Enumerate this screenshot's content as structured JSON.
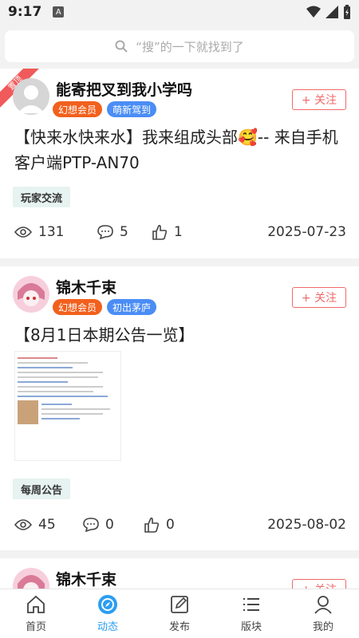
{
  "status_bar": {
    "time": "9:17",
    "a_label": "A"
  },
  "search": {
    "placeholder": "“搜”的一下就找到了"
  },
  "posts": [
    {
      "ribbon": "置顶",
      "user_name": "能寄把叉到我小学吗",
      "tags": [
        "幻想会员",
        "萌新驾到"
      ],
      "follow_label": "+ 关注",
      "title": "【快来水快来水】我来组成头部🥰-- 来自手机客户端PTP-AN70",
      "category": "玩家交流",
      "views": "131",
      "comments": "5",
      "likes": "1",
      "date": "2025-07-23"
    },
    {
      "user_name": "锦木千束",
      "tags": [
        "幻想会员",
        "初出茅庐"
      ],
      "follow_label": "+ 关注",
      "title": "【8月1日本期公告一览】",
      "category": "每周公告",
      "views": "45",
      "comments": "0",
      "likes": "0",
      "date": "2025-08-02"
    },
    {
      "user_name": "锦木千束",
      "follow_label": "+ 关注"
    }
  ],
  "nav": [
    {
      "label": "首页",
      "icon": "home-icon"
    },
    {
      "label": "动态",
      "icon": "compass-icon",
      "active": true
    },
    {
      "label": "发布",
      "icon": "edit-icon"
    },
    {
      "label": "版块",
      "icon": "list-icon"
    },
    {
      "label": "我的",
      "icon": "user-icon"
    }
  ],
  "colors": {
    "accent": "#2a9ef3",
    "follow": "#f06a6a",
    "tag_orange": "#f2601d",
    "tag_blue": "#4a8df5"
  }
}
